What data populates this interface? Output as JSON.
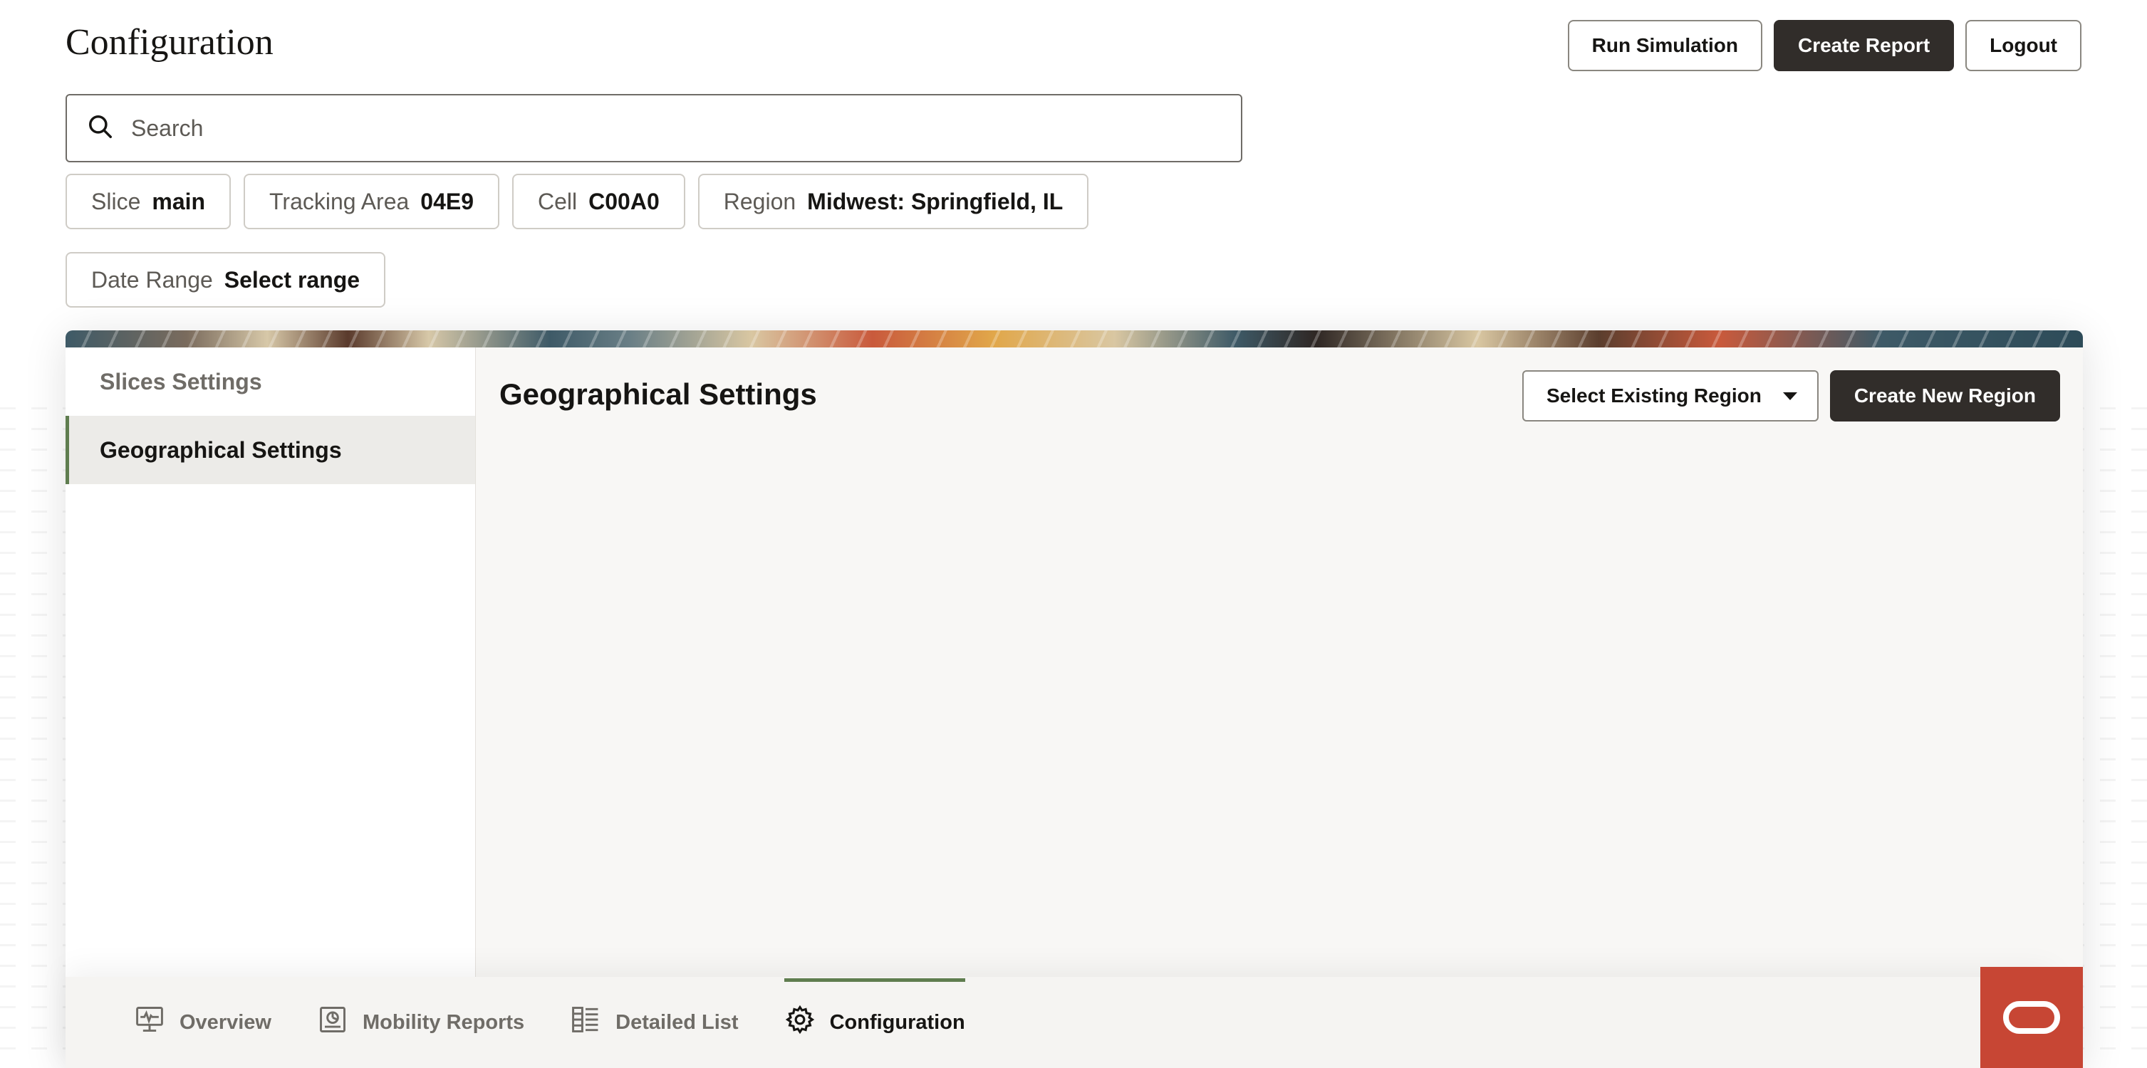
{
  "header": {
    "title": "Configuration",
    "actions": {
      "run_simulation": "Run Simulation",
      "create_report": "Create Report",
      "logout": "Logout"
    }
  },
  "search": {
    "placeholder": "Search",
    "value": ""
  },
  "filters": [
    {
      "label": "Slice",
      "value": "main"
    },
    {
      "label": "Tracking Area",
      "value": "04E9"
    },
    {
      "label": "Cell",
      "value": "C00A0"
    },
    {
      "label": "Region",
      "value": "Midwest: Springfield, IL"
    },
    {
      "label": "Date Range",
      "value": "Select range"
    }
  ],
  "sidebar": {
    "items": [
      {
        "label": "Slices Settings",
        "active": false
      },
      {
        "label": "Geographical Settings",
        "active": true
      }
    ]
  },
  "main": {
    "title": "Geographical Settings",
    "select_region_label": "Select Existing Region",
    "create_region_label": "Create New Region"
  },
  "bottom_nav": {
    "items": [
      {
        "label": "Overview",
        "icon": "monitor-icon",
        "active": false
      },
      {
        "label": "Mobility Reports",
        "icon": "report-icon",
        "active": false
      },
      {
        "label": "Detailed List",
        "icon": "list-icon",
        "active": false
      },
      {
        "label": "Configuration",
        "icon": "gear-icon",
        "active": true
      }
    ]
  },
  "colors": {
    "accent_green": "#5f7d4f",
    "dark_button": "#312d2a",
    "brand_red": "#c74634"
  }
}
